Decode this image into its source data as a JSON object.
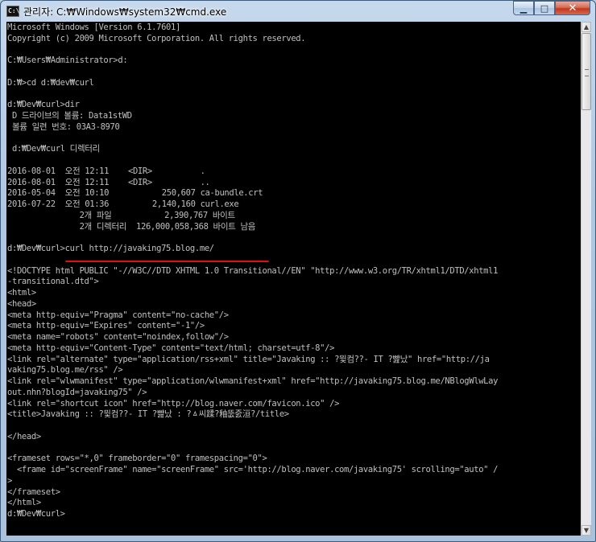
{
  "window": {
    "title": "관리자: C:₩Windows₩system32₩cmd.exe",
    "icon_label": "C:\\",
    "minimize_glyph": "▁",
    "maximize_glyph": "□",
    "close_glyph": "✕"
  },
  "scrollbar": {
    "up_glyph": "▲",
    "down_glyph": "▼"
  },
  "console": {
    "lines": [
      "Microsoft Windows [Version 6.1.7601]",
      "Copyright (c) 2009 Microsoft Corporation. All rights reserved.",
      "",
      "C:₩Users₩Administrator>d:",
      "",
      "D:₩>cd d:₩dev₩curl",
      "",
      "d:₩Dev₩curl>dir",
      " D 드라이브의 볼륨: Data1stWD",
      " 볼륨 일련 번호: 03A3-8970",
      "",
      " d:₩Dev₩curl 디렉터리",
      "",
      "2016-08-01  오전 12:11    <DIR>          .",
      "2016-08-01  오전 12:11    <DIR>          ..",
      "2016-05-04  오전 10:10           250,607 ca-bundle.crt",
      "2016-07-22  오전 01:36         2,140,160 curl.exe",
      "               2개 파일           2,390,767 바이트",
      "               2개 디렉터리  126,000,058,368 바이트 남음",
      "",
      "d:₩Dev₩curl>curl http://javaking75.blog.me/",
      "",
      "<!DOCTYPE html PUBLIC \"-//W3C//DTD XHTML 1.0 Transitional//EN\" \"http://www.w3.org/TR/xhtml1/DTD/xhtml1",
      "-transitional.dtd\">",
      "<html>",
      "<head>",
      "<meta http-equiv=\"Pragma\" content=\"no-cache\"/>",
      "<meta http-equiv=\"Expires\" content=\"-1\"/>",
      "<meta name=\"robots\" content=\"noindex,follow\"/>",
      "<meta http-equiv=\"Content-Type\" content=\"text/html; charset=utf-8\"/>",
      "<link rel=\"alternate\" type=\"application/rss+xml\" title=\"Javaking :: ?뮟컴??- IT ?뺦났\" href=\"http://ja",
      "vaking75.blog.me/rss\" />",
      "<link rel=\"wlwmanifest\" type=\"application/wlwmanifest+xml\" href=\"http://javaking75.blog.me/NBlogWlwLay",
      "out.nhn?blogId=javaking75\" />",
      "<link rel=\"shortcut icon\" href=\"http://blog.naver.com/favicon.ico\" />",
      "<title>Javaking :: ?뮟컴??- IT ?뺦났 : ?ㅿ씨蹂?釉뚮줈洹?/title>",
      "",
      "</head>",
      "",
      "<frameset rows=\"*,0\" frameborder=\"0\" framespacing=\"0\">",
      "  <frame id=\"screenFrame\" name=\"screenFrame\" src='http://blog.naver.com/javaking75' scrolling=\"auto\" /",
      ">",
      "</frameset>",
      "</html>",
      "d:₩Dev₩curl>"
    ]
  }
}
